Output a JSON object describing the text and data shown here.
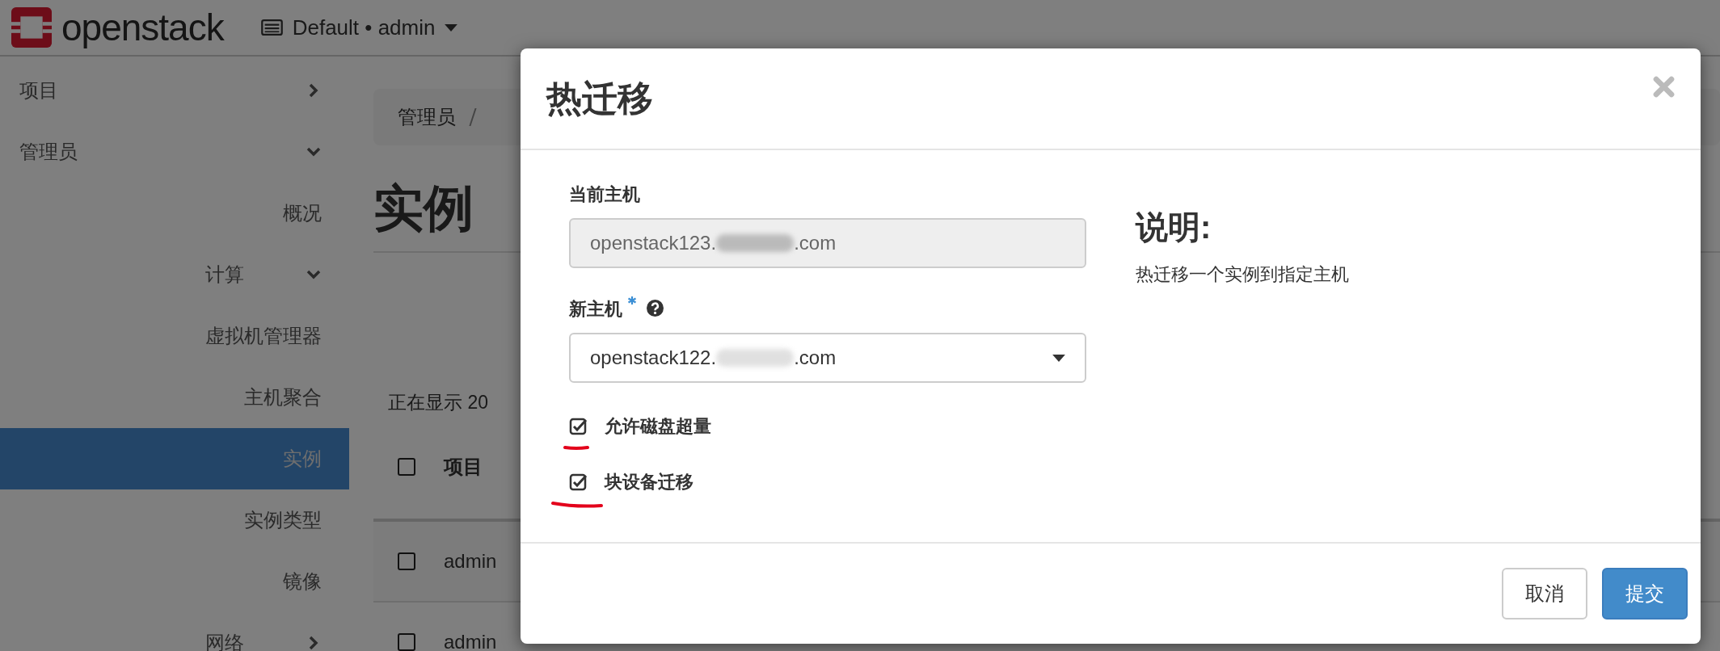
{
  "header": {
    "logo": "openstack",
    "context": "Default • admin"
  },
  "sidebar": {
    "items": [
      {
        "label": "项目",
        "expanded": false
      },
      {
        "label": "管理员",
        "expanded": true,
        "children": [
          {
            "label": "概况",
            "selected": false
          },
          {
            "label": "计算",
            "expanded": true,
            "children": [
              {
                "label": "虚拟机管理器",
                "selected": false
              },
              {
                "label": "主机聚合",
                "selected": false
              },
              {
                "label": "实例",
                "selected": true
              },
              {
                "label": "实例类型",
                "selected": false
              },
              {
                "label": "镜像",
                "selected": false
              }
            ]
          },
          {
            "label": "网络",
            "expanded": false
          }
        ]
      }
    ]
  },
  "breadcrumb": [
    "管理员"
  ],
  "page_title": "实例",
  "table": {
    "status": "正在显示 20",
    "all_checked": false,
    "columns": [
      "项目"
    ],
    "rows": [
      {
        "project": "admin",
        "checked": false
      },
      {
        "project": "admin",
        "checked": false
      }
    ]
  },
  "dialog": {
    "title": "热迁移",
    "fields": [
      {
        "kind": "text",
        "label": "当前主机",
        "required": false,
        "value": "openstack123.",
        "value_end": ".com",
        "disabled": true
      },
      {
        "kind": "select",
        "label": "新主机",
        "required": true,
        "value": "openstack122.",
        "value_end": ".com",
        "disabled": false
      }
    ],
    "checkboxes": [
      {
        "label": "允许磁盘超量",
        "checked": true
      },
      {
        "label": "块设备迁移",
        "checked": true
      }
    ],
    "help": {
      "heading": "说明:",
      "text": "热迁移一个实例到指定主机"
    },
    "buttons": [
      {
        "label": "取消",
        "kind": "default"
      },
      {
        "label": "提交",
        "kind": "primary"
      }
    ]
  }
}
